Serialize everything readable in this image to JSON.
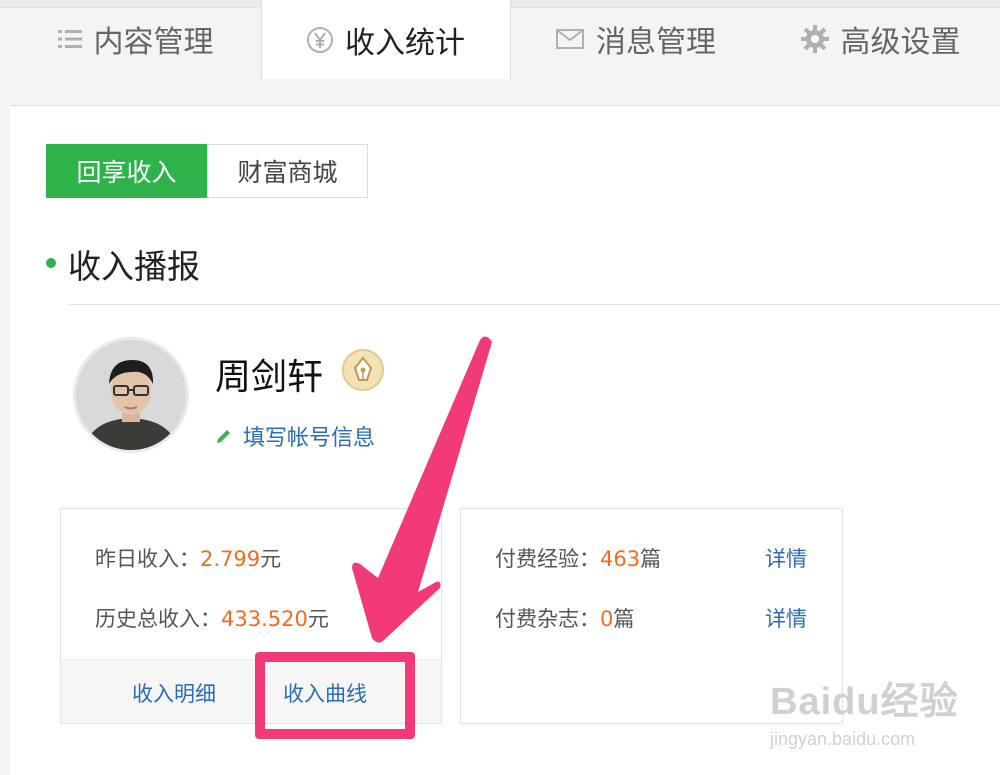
{
  "tabs": [
    {
      "label": "内容管理",
      "icon": "list-icon"
    },
    {
      "label": "收入统计",
      "icon": "yen-icon",
      "active": true
    },
    {
      "label": "消息管理",
      "icon": "mail-icon"
    },
    {
      "label": "高级设置",
      "icon": "gear-icon"
    }
  ],
  "subtabs": [
    {
      "label": "回享收入",
      "active": true
    },
    {
      "label": "财富商城"
    }
  ],
  "section": {
    "title": "收入播报"
  },
  "profile": {
    "name": "周剑轩",
    "badge_icon": "pen-nib-badge-icon",
    "edit_label": "填写帐号信息"
  },
  "income_card": {
    "yesterday_label": "昨日收入：",
    "yesterday_value": "2.799",
    "yesterday_unit": "元",
    "total_label": "历史总收入：",
    "total_value": "433.520",
    "total_unit": "元",
    "detail_link": "收入明细",
    "curve_link": "收入曲线"
  },
  "paid_card": {
    "exp_label": "付费经验：",
    "exp_value": "463",
    "exp_unit": "篇",
    "mag_label": "付费杂志：",
    "mag_value": "0",
    "mag_unit": "篇",
    "detail_label": "详情"
  },
  "watermark": {
    "logo": "Baidu经验",
    "url": "jingyan.baidu.com"
  },
  "colors": {
    "accent_green": "#2db34a",
    "value_orange": "#f26c1f",
    "link_blue": "#2a6db8",
    "annotation_pink": "#f23a78"
  }
}
